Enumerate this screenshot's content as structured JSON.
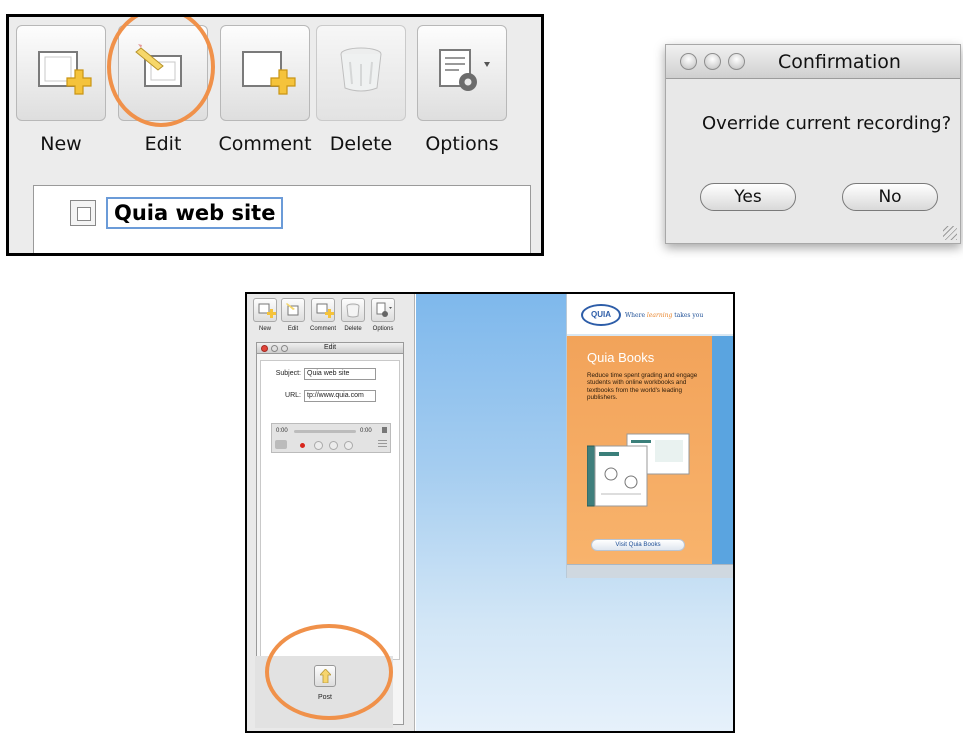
{
  "toolbar_panel": {
    "buttons": [
      {
        "label": "New",
        "icon": "new-item-icon"
      },
      {
        "label": "Edit",
        "icon": "edit-pencil-icon"
      },
      {
        "label": "Comment",
        "icon": "comment-add-icon"
      },
      {
        "label": "Delete",
        "icon": "trash-icon"
      },
      {
        "label": "Options",
        "icon": "gear-options-icon"
      }
    ],
    "tree_item_label": "Quia web site"
  },
  "dialog": {
    "title": "Confirmation",
    "message": "Override current recording?",
    "yes_label": "Yes",
    "no_label": "No"
  },
  "app": {
    "toolbar": {
      "new_label": "New",
      "edit_label": "Edit",
      "comment_label": "Comment",
      "delete_label": "Delete",
      "options_label": "Options"
    },
    "edit_window": {
      "title": "Edit",
      "subject_label": "Subject:",
      "subject_value": "Quia web site",
      "url_label": "URL:",
      "url_value": "tp://www.quia.com",
      "time_start": "0:00",
      "time_end": "0:00",
      "post_label": "Post"
    },
    "quia": {
      "logo_text": "QUIA",
      "tagline_prefix": "Where ",
      "tagline_highlight": "learning",
      "tagline_suffix": " takes you",
      "card_title": "Quia Books",
      "card_text": "Reduce time spent grading and engage students with online workbooks and textbooks from the world's leading publishers.",
      "visit_label": "Visit Quia Books"
    }
  },
  "colors": {
    "highlight_ring": "#f0914a",
    "quia_orange": "#f2a35a",
    "quia_blue": "#5aa4e0",
    "selection_blue": "#6b9bd8"
  }
}
